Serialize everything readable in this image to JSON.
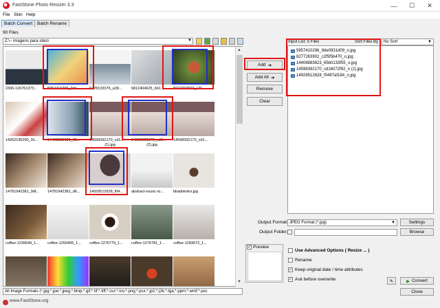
{
  "window": {
    "title": "FastStone Photo Resizer 3.3"
  },
  "menu": [
    "File",
    "Skin",
    "Help"
  ],
  "tabs": [
    "Batch Convert",
    "Batch Rename"
  ],
  "browser": {
    "file_count": "90 Files",
    "path": "Z:\\~ imagens para sites\\",
    "thumbnails": [
      {
        "label": "2306-126761373..."
      },
      {
        "label": "5957410296_9de..."
      },
      {
        "label": "6278133376_a39..."
      },
      {
        "label": "6812404625_6b1..."
      },
      {
        "label": "8277263902_c2f..."
      },
      {
        "label": "14202195290_91..."
      },
      {
        "label": "14408883623_65..."
      },
      {
        "label": "14598392170_cd1...",
        "label2": "(1).jpg"
      },
      {
        "label": "14598392170_cd1...",
        "label2": "(2).jpg"
      },
      {
        "label": "14598392170_cd1..."
      },
      {
        "label": "14781942381_9df..."
      },
      {
        "label": "14781942381_d6..."
      },
      {
        "label": "14929512628_f04..."
      },
      {
        "label": "abstract-music-ro..."
      },
      {
        "label": "bbadnknkrr.jpg"
      },
      {
        "label": "coffee-1239549_1..."
      },
      {
        "label": "coffee-1250405_1..."
      },
      {
        "label": "coffee-1276779_1..."
      },
      {
        "label": "coffee-1276781_1..."
      },
      {
        "label": "coffee-1283672_1..."
      },
      {
        "label": ""
      },
      {
        "label": ""
      },
      {
        "label": ""
      },
      {
        "label": ""
      },
      {
        "label": ""
      }
    ],
    "filter": "All Image Formats (*.jpg;*.jpe;*.jpeg;*.bmp;*.gif;*.tif;*.tiff;*.cur;*.ico;*.png;*.pcx;*.jp2;*.j2k;*.tga;*.ppm;*.wmf;*.psc",
    "status": "www.FastStone.org"
  },
  "actions": {
    "add": "Add",
    "add_all": "Add All",
    "remove": "Remove",
    "clear": "Clear"
  },
  "input_list": {
    "header": "Input List:  5 Files",
    "sort_label": "Sort Files By",
    "sort_value": "No Sort",
    "files": [
      "5957410296_9de0931d09_o.jpg",
      "8277263902_c2f5f5b470_o.jpg",
      "14408883623_65b0133f55_o.jpg",
      "14598392170_cd16072f92_o (2).jpg",
      "14929512628_f0497af184_o.jpg"
    ]
  },
  "output": {
    "format_label": "Output Format:",
    "format_value": "JPEG Format (*.jpg)",
    "settings": "Settings",
    "folder_label": "Output Folder:",
    "browse": "Browse"
  },
  "options": {
    "preview": "Preview",
    "advanced": "Use Advanced Options ( Resize ... )",
    "rename": "Rename",
    "keep_date": "Keep original date / time attributes",
    "ask_overwrite": "Ask before overwrite"
  },
  "buttons": {
    "convert": "Convert",
    "close": "Close"
  }
}
